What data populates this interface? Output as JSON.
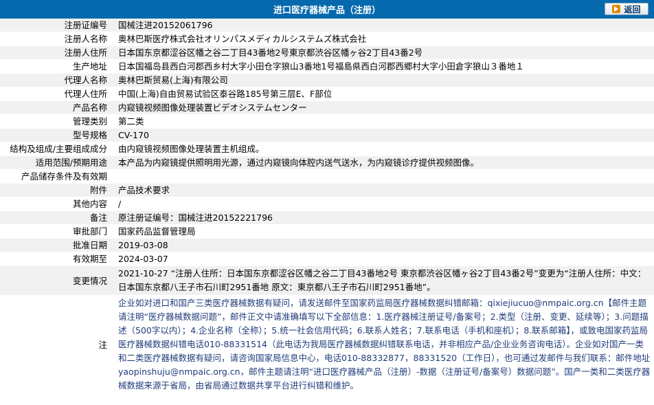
{
  "header": {
    "title": "进口医疗器械产品（注册）",
    "back_label": "返回"
  },
  "rows": [
    {
      "label": "注册证编号",
      "value": "国械注进20152061796"
    },
    {
      "label": "注册人名称",
      "value": "奥林巴斯医疗株式会社オリンパスメディカルシステムズ株式会社"
    },
    {
      "label": "注册人住所",
      "value": "日本国东京都涩谷区幡之谷二丁目43番地2号東京都渋谷区幡ヶ谷2丁目43番2号"
    },
    {
      "label": "生产地址",
      "value": "日本国福岛县西白河郡西乡村大字小田仓字狼山3番地1号福島県西白河郡西郷村大字小田倉字狼山３番地１"
    },
    {
      "label": "代理人名称",
      "value": "奥林巴斯贸易(上海)有限公司"
    },
    {
      "label": "代理人住所",
      "value": "中国(上海)自由贸易试验区泰谷路185号第三层E、F部位"
    },
    {
      "label": "产品名称",
      "value": "内窥镜视频图像处理装置ビデオシステムセンター"
    },
    {
      "label": "管理类别",
      "value": "第二类"
    },
    {
      "label": "型号规格",
      "value": "CV-170"
    },
    {
      "label": "结构及组成/主要组成成分",
      "value": "由内窥镜视频图像处理装置主机组成。"
    },
    {
      "label": "适用范围/预期用途",
      "value": "本产品为内窥镜提供照明用光源，通过内窥镜向体腔内送气送水，为内窥镜诊疗提供视频图像。"
    },
    {
      "label": "产品储存条件及有效期",
      "value": ""
    },
    {
      "label": "附件",
      "value": "产品技术要求"
    },
    {
      "label": "其他内容",
      "value": "/"
    },
    {
      "label": "备注",
      "value": "原注册证编号：国械注进20152221796"
    },
    {
      "label": "审批部门",
      "value": "国家药品监督管理局"
    },
    {
      "label": "批准日期",
      "value": "2019-03-08"
    },
    {
      "label": "有效期至",
      "value": "2024-03-07"
    },
    {
      "label": "变更情况",
      "value": "2021-10-27 “注册人住所：日本国东京都涩谷区幡之谷二丁目43番地2号 東京都渋谷区幡ヶ谷2丁目43番2号”变更为“注册人住所：中文：日本国东京都八王子市石川町2951番地 原文：東京都八王子市石川町2951番地”。"
    },
    {
      "label": "注",
      "value": "企业如对进口和国产三类医疗器械数据有疑问，请发送邮件至国家药监局医疗器械数据纠错邮箱：qixiejiucuo@nmpaic.org.cn【邮件主题请注明“医疗器械数据问题”，邮件正文中请准确填写以下全部信息：1.医疗器械注册证号/备案号；2.类型（注册、变更、延续等）；3.问题描述（500字以内）；4.企业名称（全称）；5.统一社会信用代码；6.联系人姓名；7.联系电话（手机和座机）；8.联系邮箱】，或致电国家药监局医疗器械数据纠错电话010-88331514（此电话为我局医疗器械数据纠错联系电话，并非相应产品/企业业务咨询电话）。企业如对国产一类和二类医疗器械数据有疑问，请咨询国家局信息中心，电话010-88332877，88331520（工作日），也可通过发邮件与我们联系：邮件地址yaopinshuju@nmpaic.org.cn，邮件主题请注明“进口医疗器械产品（注册）-数据（注册证号/备案号）数据问题”。国产一类和二类医疗器械数据来源于省局，由省局通过数据共享平台进行纠错和维护。"
    }
  ]
}
